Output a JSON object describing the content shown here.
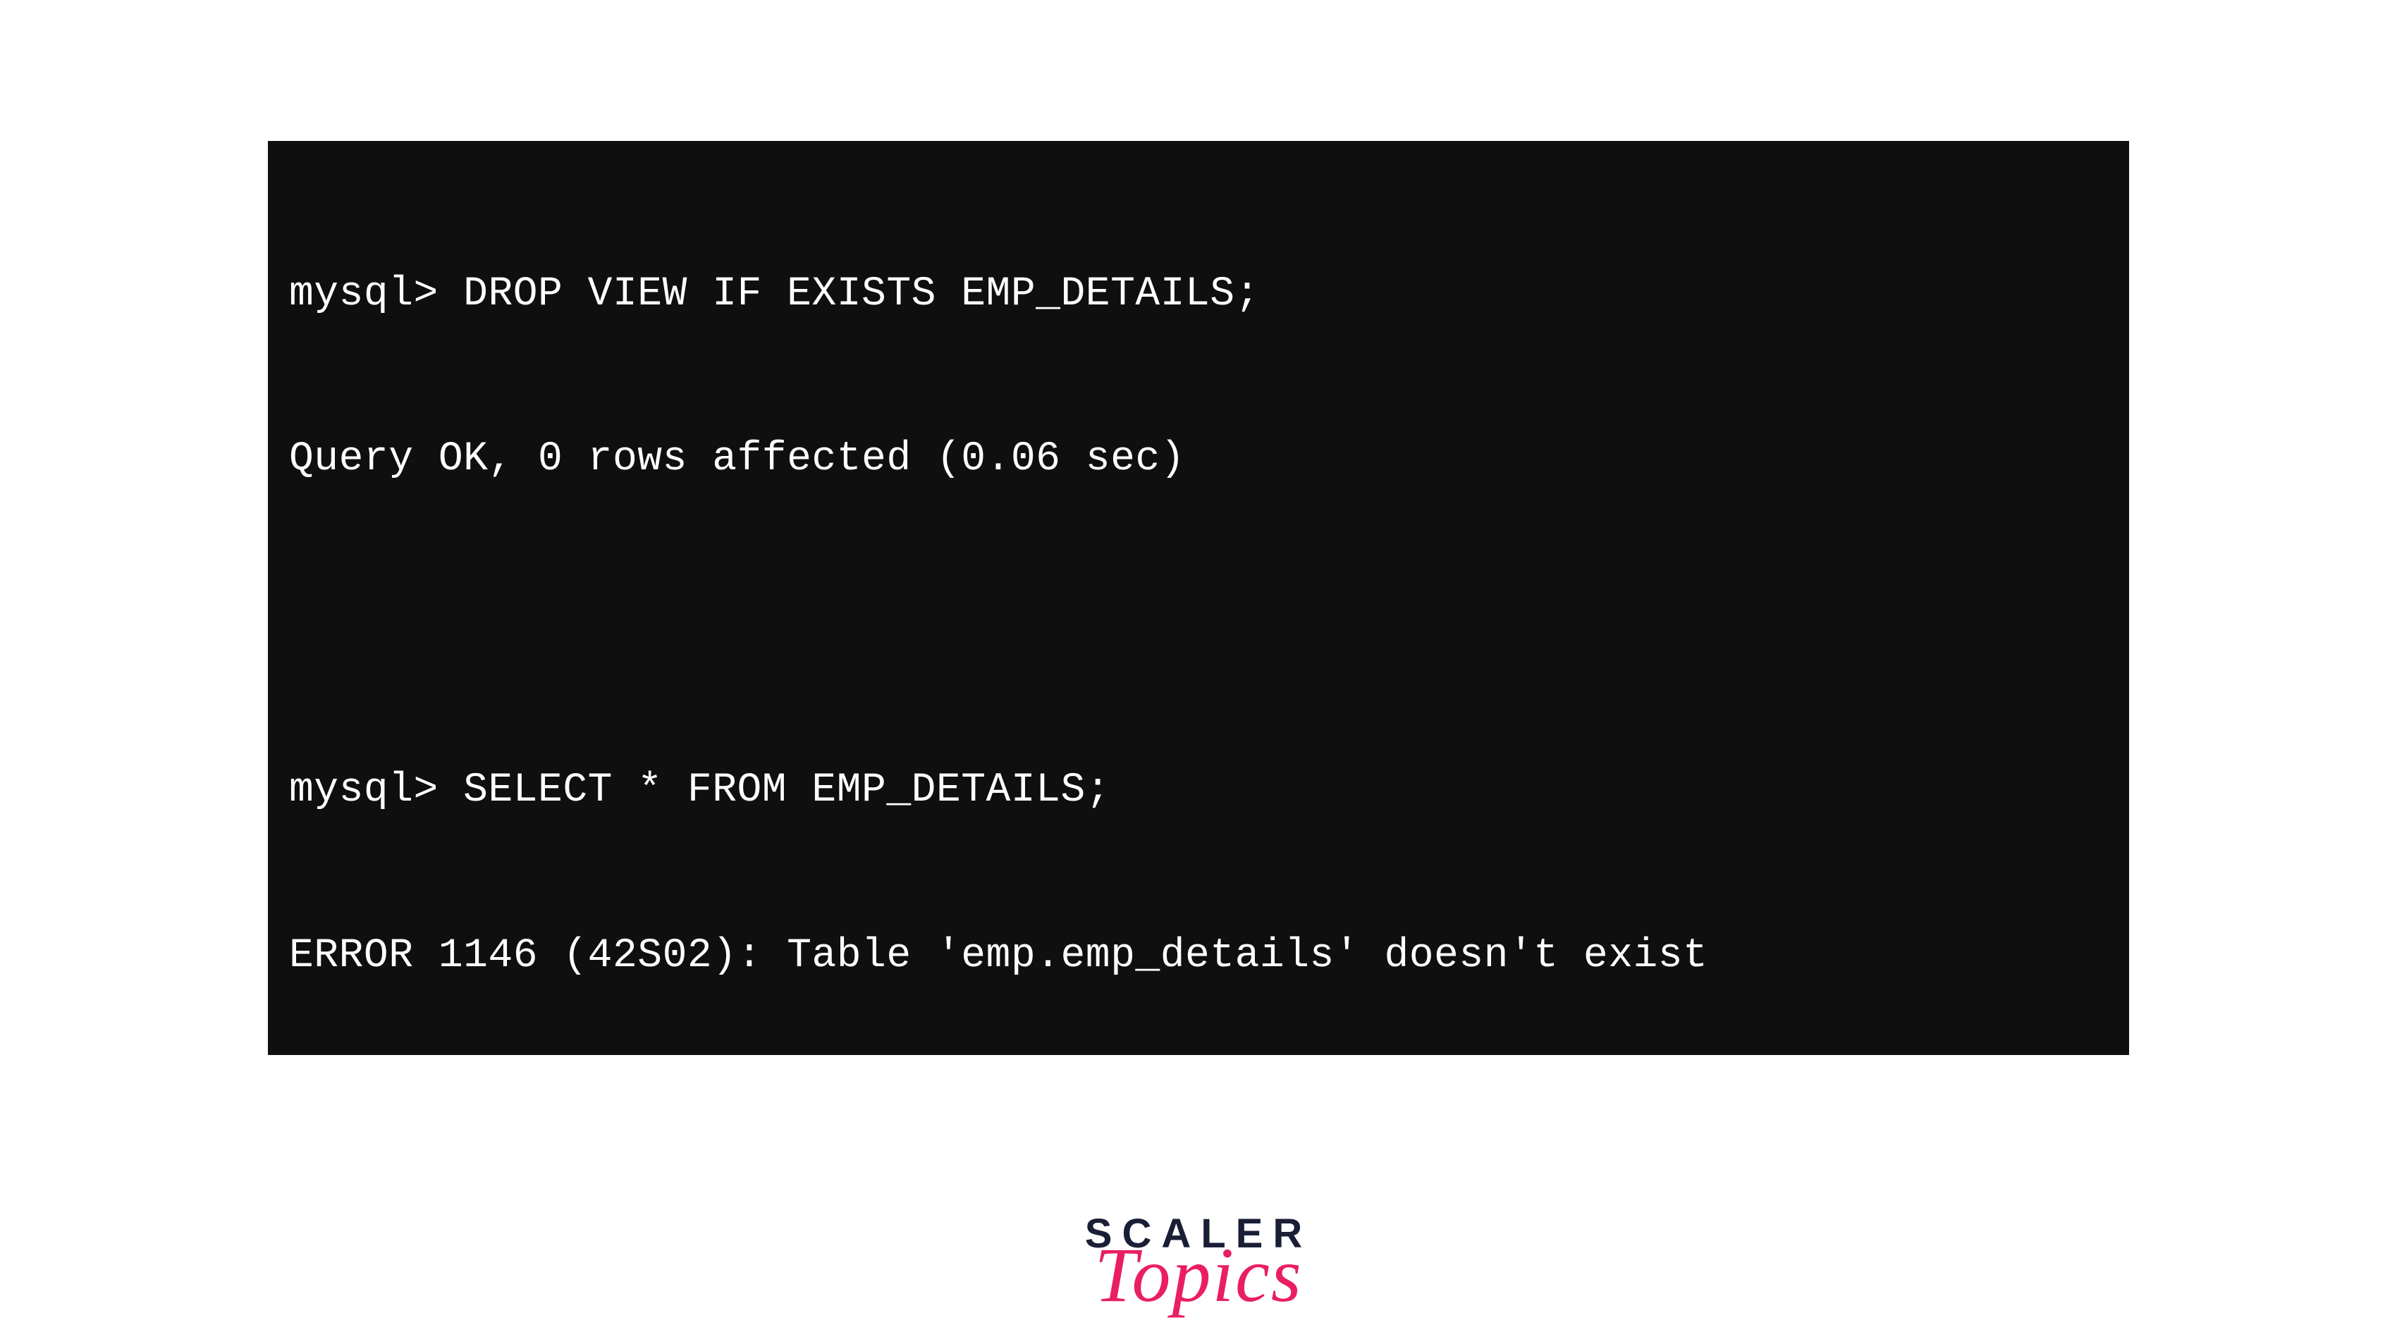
{
  "terminal": {
    "lines": [
      "mysql> DROP VIEW IF EXISTS EMP_DETAILS;",
      "Query OK, 0 rows affected (0.06 sec)",
      "",
      "mysql> SELECT * FROM EMP_DETAILS;",
      "ERROR 1146 (42S02): Table 'emp.emp_details' doesn't exist"
    ]
  },
  "logo": {
    "primary": "SCALER",
    "secondary": "Topics"
  }
}
